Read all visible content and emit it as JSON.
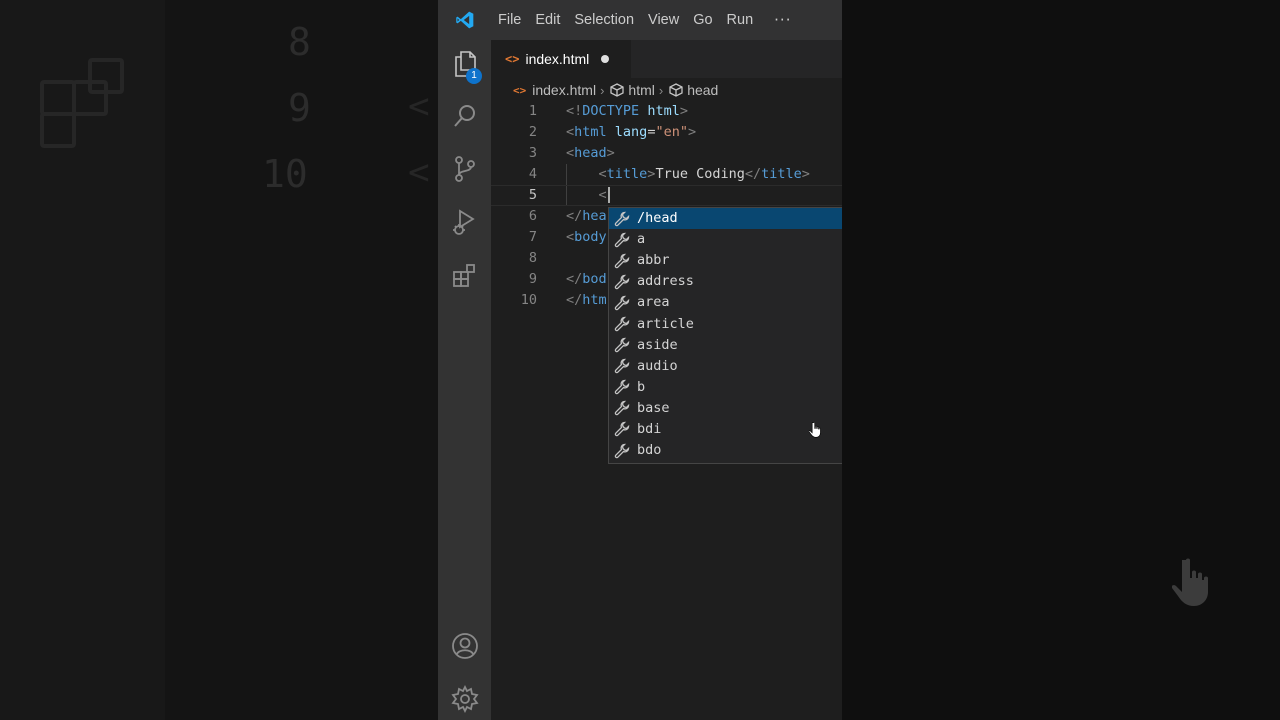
{
  "titlebar": {
    "menu": [
      "File",
      "Edit",
      "Selection",
      "View",
      "Go",
      "Run"
    ],
    "more": "···"
  },
  "activity_bar": {
    "items": [
      "files-icon",
      "search-icon",
      "source-control-icon",
      "run-debug-icon",
      "extensions-icon"
    ],
    "bottom": [
      "account-icon",
      "manage-gear-icon"
    ],
    "explorer_badge": "1"
  },
  "tab": {
    "label": "index.html",
    "icon": "<>",
    "modified": true
  },
  "breadcrumb": {
    "file": "index.html",
    "items": [
      "html",
      "head"
    ]
  },
  "editor": {
    "line_numbers": [
      "1",
      "2",
      "3",
      "4",
      "5",
      "6",
      "7",
      "8",
      "9",
      "10"
    ],
    "current_line": 5,
    "lines": [
      [
        [
          "p",
          "<!"
        ],
        [
          "t",
          "DOCTYPE"
        ],
        [
          "x",
          " "
        ],
        [
          "a",
          "html"
        ],
        [
          "p",
          ">"
        ]
      ],
      [
        [
          "p",
          "<"
        ],
        [
          "t",
          "html"
        ],
        [
          "x",
          " "
        ],
        [
          "a",
          "lang"
        ],
        [
          "x",
          "="
        ],
        [
          "s",
          "\"en\""
        ],
        [
          "p",
          ">"
        ]
      ],
      [
        [
          "p",
          "<"
        ],
        [
          "t",
          "head"
        ],
        [
          "p",
          ">"
        ]
      ],
      [
        [
          "x",
          "    "
        ],
        [
          "p",
          "<"
        ],
        [
          "t",
          "title"
        ],
        [
          "p",
          ">"
        ],
        [
          "x",
          "True Coding"
        ],
        [
          "p",
          "</"
        ],
        [
          "t",
          "title"
        ],
        [
          "p",
          ">"
        ]
      ],
      [
        [
          "x",
          "    "
        ],
        [
          "p",
          "<"
        ]
      ],
      [
        [
          "p",
          "</"
        ],
        [
          "t",
          "hea"
        ]
      ],
      [
        [
          "p",
          "<"
        ],
        [
          "t",
          "body"
        ]
      ],
      [],
      [
        [
          "p",
          "</"
        ],
        [
          "t",
          "bod"
        ]
      ],
      [
        [
          "p",
          "</"
        ],
        [
          "t",
          "htm"
        ]
      ]
    ]
  },
  "suggestions": {
    "selected_index": 0,
    "items": [
      "/head",
      "a",
      "abbr",
      "address",
      "area",
      "article",
      "aside",
      "audio",
      "b",
      "base",
      "bdi",
      "bdo"
    ]
  },
  "colors": {
    "accent": "#007acc",
    "selection": "#094771",
    "tag": "#569cd6",
    "attr": "#9cdcfe",
    "string": "#ce9178",
    "html_icon": "#e37933"
  }
}
